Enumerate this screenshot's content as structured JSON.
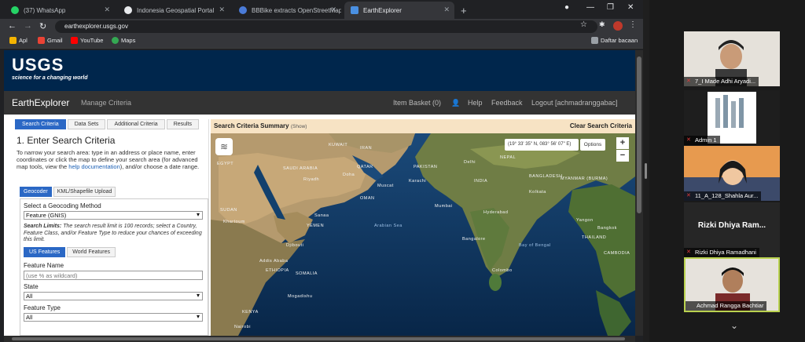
{
  "browser": {
    "tabs": [
      {
        "label": "(37) WhatsApp",
        "color": "#25d366"
      },
      {
        "label": "Indonesia Geospatial Portal",
        "color": "#e8eaed"
      },
      {
        "label": "BBBike extracts OpenStreetMap",
        "color": "#4a7bd8"
      },
      {
        "label": "EarthExplorer",
        "color": "#4a90e2"
      }
    ],
    "new_tab": "+",
    "url": "earthexplorer.usgs.gov",
    "bookmarks": [
      {
        "label": "Apl",
        "color": "#f4b400"
      },
      {
        "label": "Gmail",
        "color": "#ea4335"
      },
      {
        "label": "YouTube",
        "color": "#ff0000"
      },
      {
        "label": "Maps",
        "color": "#34a853"
      }
    ],
    "reading_list": "Daftar bacaan"
  },
  "usgs": {
    "logo": "USGS",
    "tagline": "science for a changing world"
  },
  "ee_nav": {
    "title": "EarthExplorer",
    "manage": "Manage Criteria",
    "item_basket": "Item Basket (0)",
    "help": "Help",
    "feedback": "Feedback",
    "logout": "Logout [achmadranggabac]"
  },
  "panel": {
    "tabs": [
      "Search Criteria",
      "Data Sets",
      "Additional Criteria",
      "Results"
    ],
    "heading": "1. Enter Search Criteria",
    "desc_pre": "To narrow your search area: type in an address or place name, enter coordinates or click the map to define your search area (for advanced map tools, view the ",
    "desc_link": "help documentation",
    "desc_post": "), and/or choose a date range.",
    "subtabs": [
      "Geocoder",
      "KML/Shapefile Upload"
    ],
    "geocoding_label": "Select a Geocoding Method",
    "geocoding_value": "Feature (GNIS)",
    "limits_bold": "Search Limits:",
    "limits_text": " The search result limit is 100 records; select a Country, Feature Class, and/or Feature Type to reduce your chances of exceeding this limit.",
    "feature_tabs": [
      "US Features",
      "World Features"
    ],
    "feature_name_label": "Feature Name",
    "feature_name_placeholder": "(use % as wildcard)",
    "state_label": "State",
    "state_value": "All",
    "feature_type_label": "Feature Type",
    "feature_type_value": "All"
  },
  "map": {
    "summary_title": "Search Criteria Summary",
    "summary_show": "(Show)",
    "clear": "Clear Search Criteria",
    "coords": "(19° 33' 35\" N, 083° 56' 07\" E)",
    "options": "Options",
    "zoom_in": "+",
    "zoom_out": "−",
    "labels": [
      {
        "t": "KUWAIT"
      },
      {
        "t": "QATAR"
      },
      {
        "t": "SAUDI ARABIA"
      },
      {
        "t": "OMAN"
      },
      {
        "t": "YEMEN"
      },
      {
        "t": "ETHIOPIA"
      },
      {
        "t": "SOMALIA"
      },
      {
        "t": "KENYA"
      },
      {
        "t": "EGYPT"
      },
      {
        "t": "SUDAN"
      },
      {
        "t": "IRAN"
      },
      {
        "t": "PAKISTAN"
      },
      {
        "t": "INDIA"
      },
      {
        "t": "NEPAL"
      },
      {
        "t": "BANGLADESH"
      },
      {
        "t": "MYANMAR (BURMA)"
      },
      {
        "t": "THAILAND"
      },
      {
        "t": "CAMBODIA"
      },
      {
        "t": "Arabian Sea"
      },
      {
        "t": "Bay of Bengal"
      },
      {
        "t": "Mumbai"
      },
      {
        "t": "Hyderabad"
      },
      {
        "t": "Bangalore"
      },
      {
        "t": "Colombo"
      },
      {
        "t": "Kolkata"
      },
      {
        "t": "Yangon"
      },
      {
        "t": "Bangkok"
      },
      {
        "t": "Delhi"
      },
      {
        "t": "Karachi"
      },
      {
        "t": "Muscat"
      },
      {
        "t": "Riyadh"
      },
      {
        "t": "Doha"
      },
      {
        "t": "Sanaa"
      },
      {
        "t": "Djibouti"
      },
      {
        "t": "Mogadishu"
      },
      {
        "t": "Nairobi"
      },
      {
        "t": "Khartoum"
      },
      {
        "t": "Addis Ababa"
      }
    ]
  },
  "meeting": {
    "participants": [
      {
        "name": "7_I Made Adhi Aryadi...",
        "kind": "video"
      },
      {
        "name": "Admin 1",
        "kind": "logo"
      },
      {
        "name": "11_A_128_Shahla Aur...",
        "kind": "video"
      },
      {
        "name": "Rizki Dhiya Ramadhani",
        "display": "Rizki Dhiya Ram...",
        "kind": "name"
      },
      {
        "name": "Achmad Rangga Bachtiar",
        "kind": "video",
        "active": true
      }
    ],
    "accent": "#bad24f",
    "more": "⌄"
  }
}
